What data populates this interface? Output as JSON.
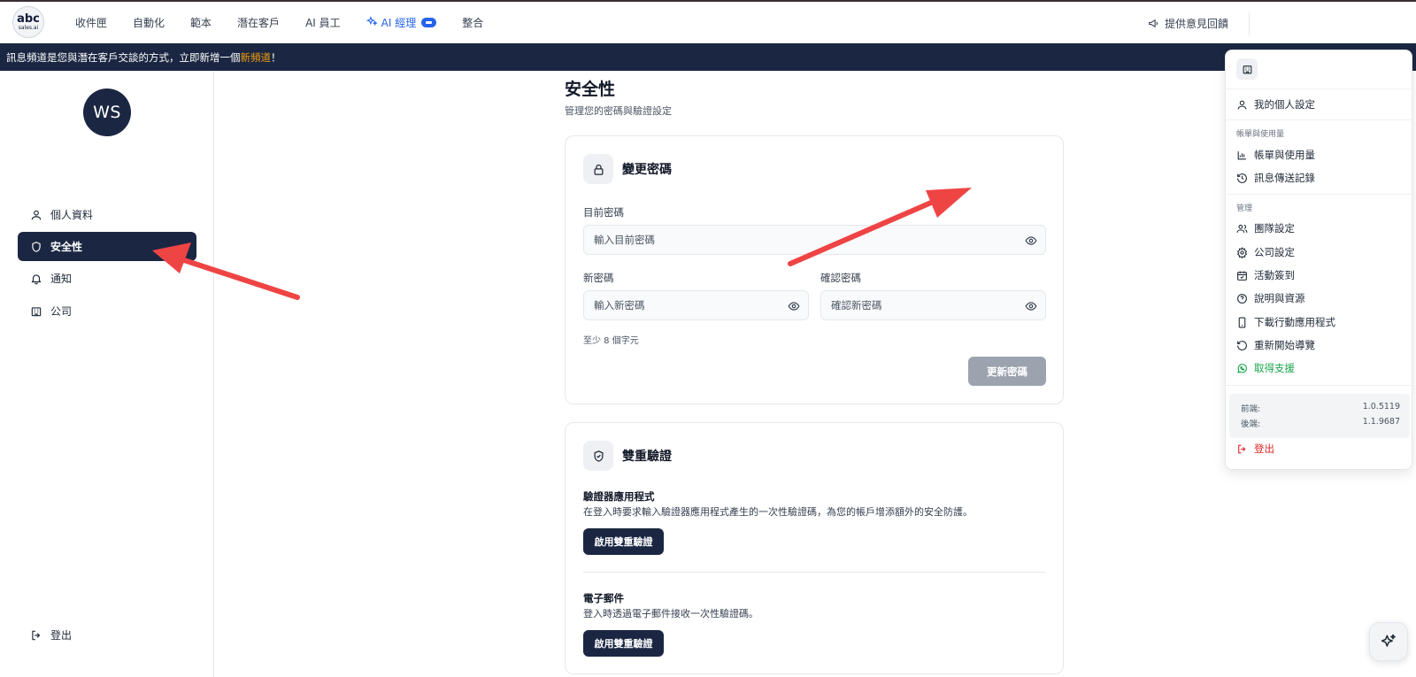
{
  "app": {
    "logo_line1": "abc",
    "logo_line2": "sales.ai"
  },
  "nav": {
    "items": [
      {
        "label": "收件匣"
      },
      {
        "label": "自動化"
      },
      {
        "label": "範本"
      },
      {
        "label": "潛在客戶"
      },
      {
        "label": "AI 員工"
      },
      {
        "label": "AI 經理"
      },
      {
        "label": "整合"
      }
    ],
    "feedback_label": "提供意見回饋"
  },
  "banner": {
    "text": "訊息頻道是您與潛在客戶交談的方式，立即新增一個 ",
    "link": "新頻道",
    "suffix": "！"
  },
  "sidebar": {
    "avatar_initials": "WS",
    "items": [
      {
        "label": "個人資料",
        "icon": "user-icon"
      },
      {
        "label": "安全性",
        "icon": "shield-icon"
      },
      {
        "label": "通知",
        "icon": "bell-icon"
      },
      {
        "label": "公司",
        "icon": "building-icon"
      }
    ],
    "logout_label": "登出"
  },
  "main": {
    "title": "安全性",
    "subtitle": "管理您的密碼與驗證設定",
    "change_password": {
      "title": "變更密碼",
      "current_label": "目前密碼",
      "current_placeholder": "輸入目前密碼",
      "new_label": "新密碼",
      "new_placeholder": "輸入新密碼",
      "confirm_label": "確認密碼",
      "confirm_placeholder": "確認新密碼",
      "hint": "至少 8 個字元",
      "update_button": "更新密碼"
    },
    "two_factor": {
      "title": "雙重驗證",
      "app_title": "驗證器應用程式",
      "app_desc": "在登入時要求輸入驗證器應用程式產生的一次性驗證碼，為您的帳戶增添額外的安全防護。",
      "app_button": "啟用雙重驗證",
      "email_title": "電子郵件",
      "email_desc": "登入時透過電子郵件接收一次性驗證碼。",
      "email_button": "啟用雙重驗證"
    }
  },
  "menu": {
    "profile": "我的個人設定",
    "group_billing": "帳單與使用量",
    "billing": "帳單與使用量",
    "message_log": "訊息傳送記錄",
    "group_manage": "管理",
    "team": "團隊設定",
    "company": "公司設定",
    "checkin": "活動簽到",
    "help": "說明與資源",
    "download": "下載行動應用程式",
    "restart_tour": "重新開始導覽",
    "support": "取得支援",
    "frontend_label": "前端:",
    "frontend_version": "1.0.5119",
    "backend_label": "後端:",
    "backend_version": "1.1.9687",
    "logout": "登出"
  },
  "colors": {
    "navy": "#1b2742",
    "accent_blue": "#2563eb",
    "banner_highlight": "#f59e0b",
    "support_green": "#16a34a",
    "logout_red": "#dc2626",
    "arrow_red": "#ef4444"
  }
}
